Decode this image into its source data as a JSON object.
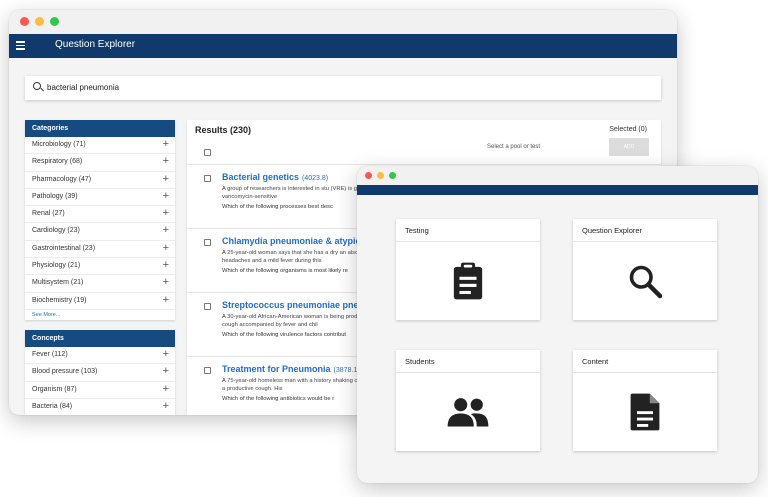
{
  "explorer": {
    "title": "Question Explorer",
    "search_value": "bacterial pneumonia",
    "categories": {
      "header": "Categories",
      "items": [
        {
          "label": "Microbiology (71)"
        },
        {
          "label": "Respiratory (68)"
        },
        {
          "label": "Pharmacology (47)"
        },
        {
          "label": "Pathology (39)"
        },
        {
          "label": "Renal (27)"
        },
        {
          "label": "Cardiology (23)"
        },
        {
          "label": "Gastrointestinal (23)"
        },
        {
          "label": "Physiology (21)"
        },
        {
          "label": "Multisystem (21)"
        },
        {
          "label": "Biochemistry (19)"
        }
      ],
      "see_more": "See More..."
    },
    "concepts": {
      "header": "Concepts",
      "items": [
        {
          "label": "Fever (112)"
        },
        {
          "label": "Blood pressure (103)"
        },
        {
          "label": "Organism (87)"
        },
        {
          "label": "Bacteria (84)"
        }
      ]
    },
    "results": {
      "title": "Results (230)",
      "selected": "Selected (0)",
      "pool_placeholder": "Select a pool or test",
      "add_label": "ADD",
      "items": [
        {
          "title": "Bacterial genetics",
          "score": "(4023.8)",
          "desc": "A group of researchers is interested in stu (VRE) is grown with vancomycin-sensitive",
          "question": "Which of the following processes best desc"
        },
        {
          "title": "Chlamydia pneumoniae & atypical p",
          "score": "",
          "desc": "A 25-year-old woman says that she has a dry an also had headaches and a mild fever during this",
          "question": "Which of the following organisms is most likely re"
        },
        {
          "title": "Streptococcus pneumoniae pneum",
          "score": "",
          "desc": "A 30-year-old African-American woman is being productive cough accompanied by fever and chil",
          "question": "Which of the following virulence factors contribut"
        },
        {
          "title": "Treatment for Pneumonia",
          "score": "(3878.15)",
          "desc": "A 75-year-old homeless man with a history shaking chills, and a productive cough. His",
          "question": "Which of the following antibiotics would be r"
        }
      ]
    }
  },
  "dashboard": {
    "cards": [
      {
        "label": "Testing",
        "icon": "clipboard-icon"
      },
      {
        "label": "Question Explorer",
        "icon": "search-icon"
      },
      {
        "label": "Students",
        "icon": "people-icon"
      },
      {
        "label": "Content",
        "icon": "document-icon"
      }
    ]
  },
  "colors": {
    "navy": "#0f3a6b",
    "panel_header": "#164b82",
    "link": "#1f6fcb"
  }
}
